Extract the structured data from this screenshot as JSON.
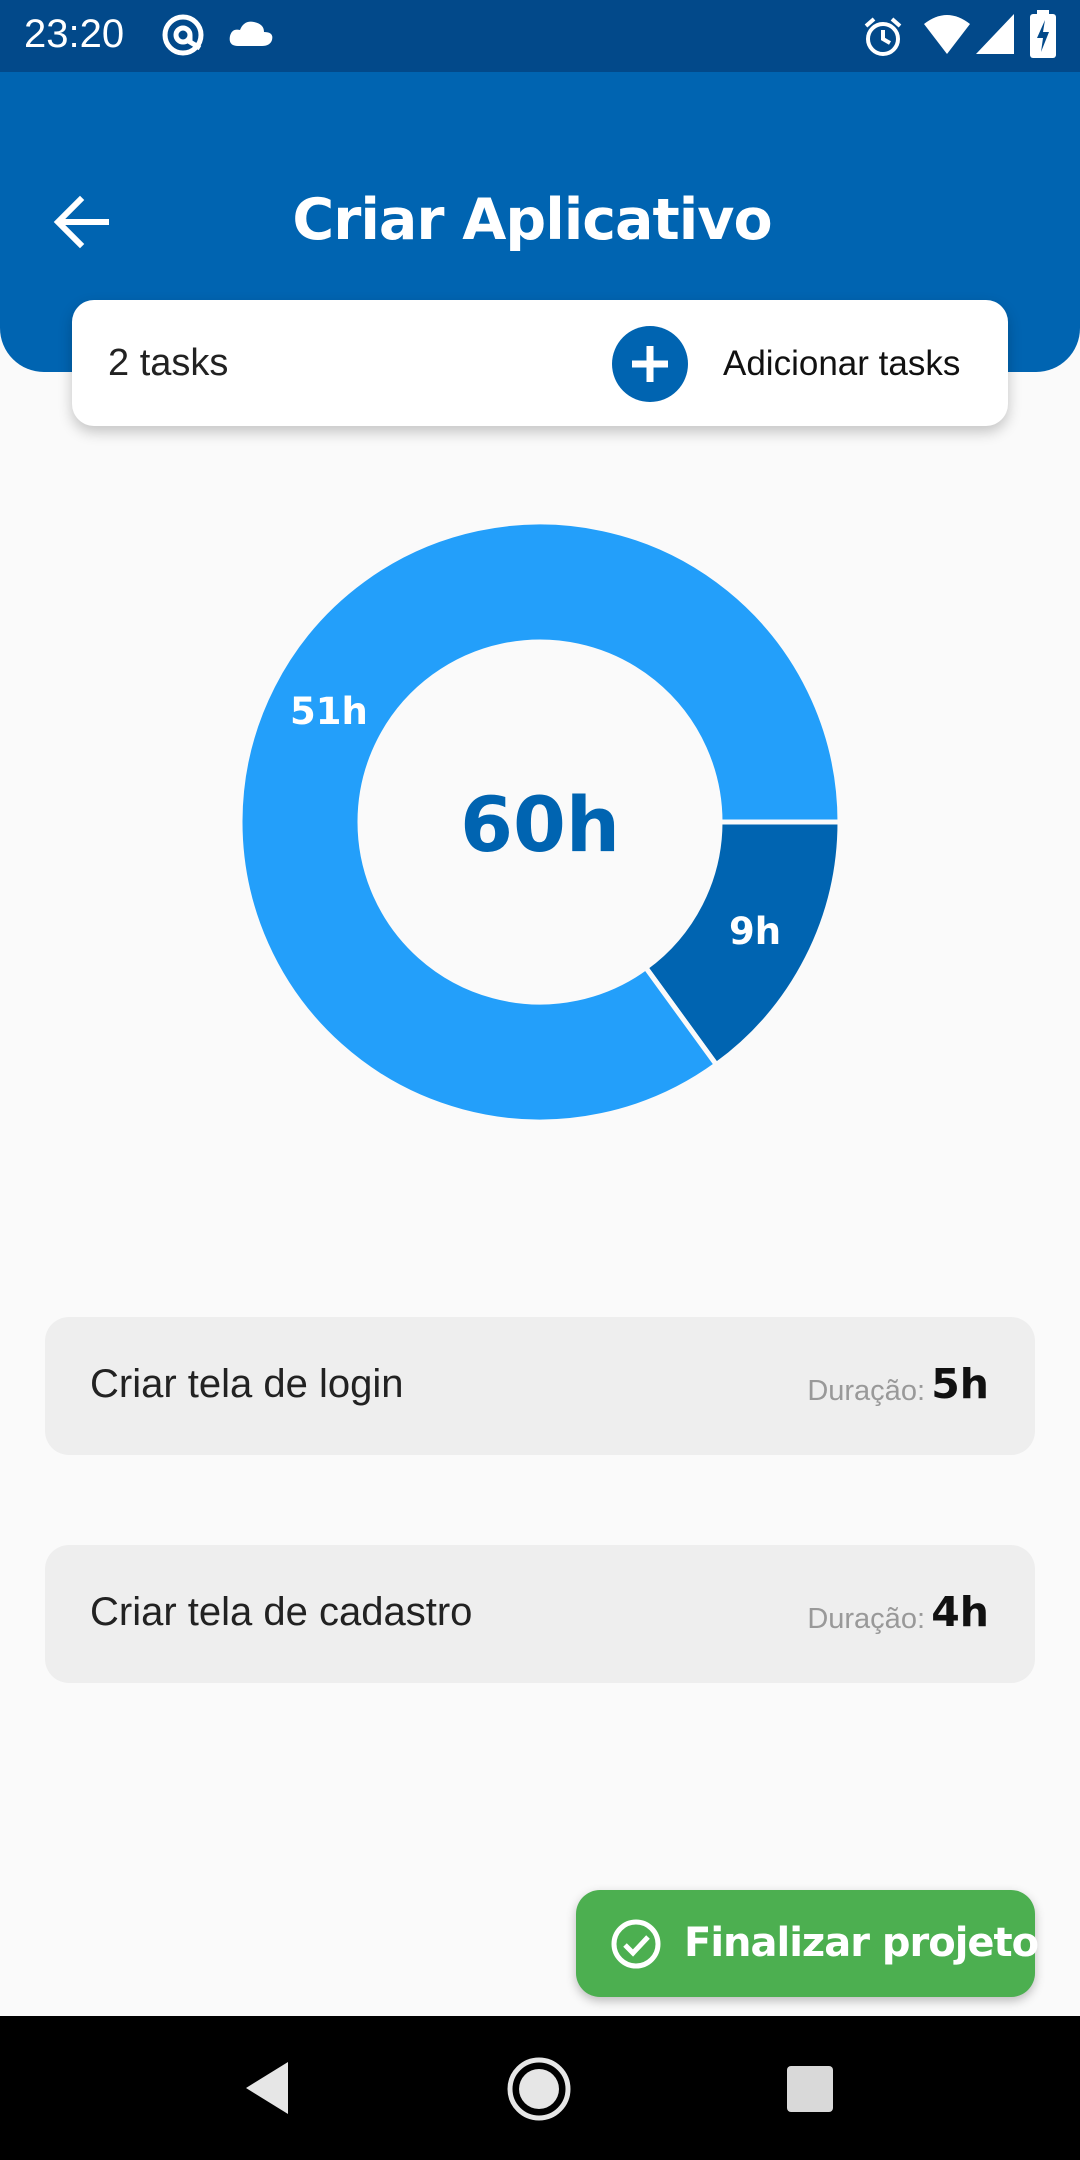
{
  "status_bar": {
    "time": "23:20",
    "left_icons": [
      "at-sign-icon",
      "cloud-icon"
    ],
    "right_icons": [
      "alarm-icon",
      "wifi-icon",
      "signal-icon",
      "battery-charging-icon"
    ]
  },
  "header": {
    "title": "Criar Aplicativo",
    "back_icon": "arrow-left-icon",
    "background": "#0064b1"
  },
  "task_summary": {
    "count_text": "2 tasks",
    "add_label": "Adicionar tasks",
    "add_icon": "plus-circle-icon"
  },
  "chart_data": {
    "type": "pie",
    "center_label": "60h",
    "slices": [
      {
        "label": "51h",
        "value": 51,
        "color": "#239ffa"
      },
      {
        "label": "9h",
        "value": 9,
        "color": "#0064b1"
      }
    ]
  },
  "tasks": [
    {
      "name": "Criar tela de login",
      "duration_label": "Duração:",
      "duration": "5h"
    },
    {
      "name": "Criar tela de cadastro",
      "duration_label": "Duração:",
      "duration": "4h"
    }
  ],
  "finish": {
    "label": "Finalizar projeto",
    "icon": "check-circle-icon",
    "color": "#4caf50"
  },
  "nav": {
    "buttons": [
      "back-triangle-icon",
      "home-circle-icon",
      "recents-square-icon"
    ]
  }
}
